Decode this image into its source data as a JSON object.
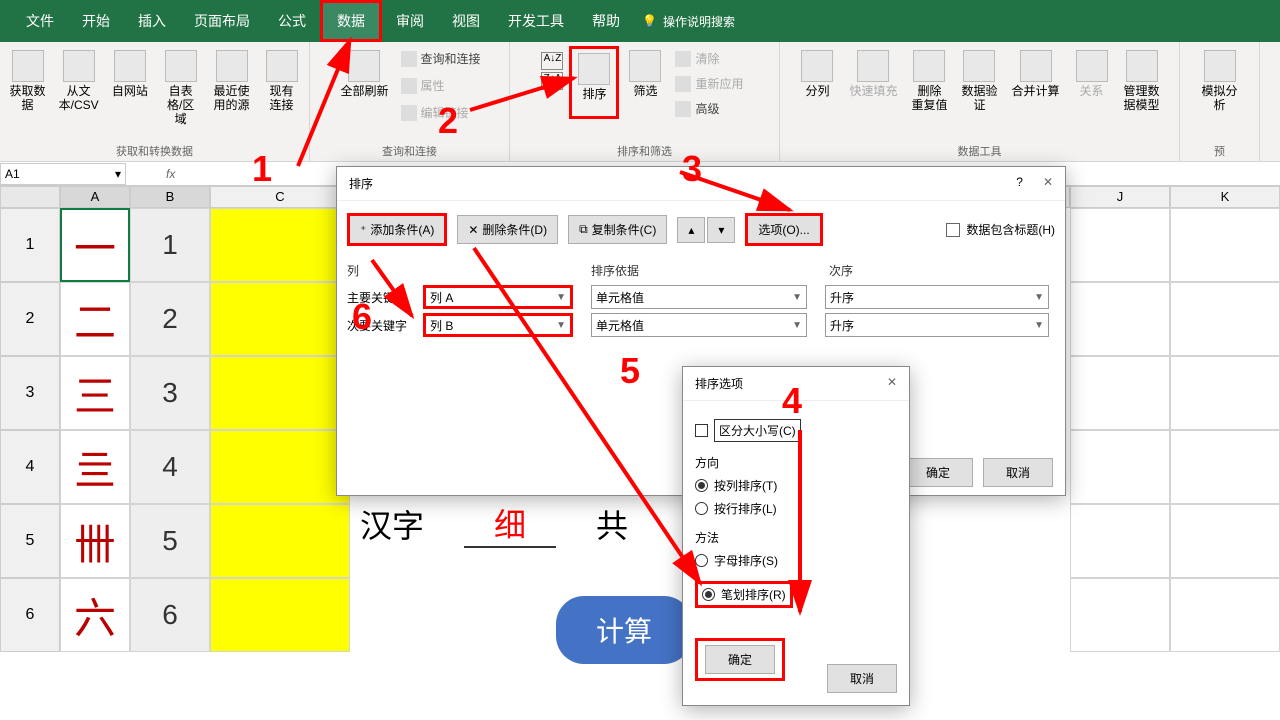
{
  "menu": {
    "file": "文件",
    "home": "开始",
    "insert": "插入",
    "layout": "页面布局",
    "formula": "公式",
    "data": "数据",
    "review": "审阅",
    "view": "视图",
    "dev": "开发工具",
    "help": "帮助",
    "tell": "操作说明搜索"
  },
  "ribbon": {
    "get": {
      "main": "获取数\n据",
      "csv": "从文\n本/CSV",
      "web": "自网站",
      "range": "自表\n格/区域",
      "recent": "最近使\n用的源",
      "exist": "现有\n连接",
      "label": "获取和转换数据"
    },
    "conn": {
      "refresh": "全部刷新",
      "q": "查询和连接",
      "prop": "属性",
      "link": "编辑链接",
      "label": "查询和连接"
    },
    "sortf": {
      "sort": "排序",
      "filter": "筛选",
      "clear": "清除",
      "reapply": "重新应用",
      "adv": "高级",
      "label": "排序和筛选"
    },
    "tools": {
      "split": "分列",
      "flash": "快速填充",
      "dup": "删除\n重复值",
      "valid": "数据验\n证",
      "consol": "合并计算",
      "rel": "关系",
      "model": "管理数\n据模型",
      "label": "数据工具"
    },
    "what": {
      "whatif": "模拟分析",
      "fore": "预"
    }
  },
  "namebox": "A1",
  "cols": [
    "A",
    "B",
    "C",
    "J",
    "K"
  ],
  "rows": [
    {
      "n": "1",
      "a": "一",
      "b": "1"
    },
    {
      "n": "2",
      "a": "二",
      "b": "2"
    },
    {
      "n": "3",
      "a": "三",
      "b": "3"
    },
    {
      "n": "4",
      "a": "亖",
      "b": "4"
    },
    {
      "n": "5",
      "a": "卌",
      "b": "5"
    },
    {
      "n": "6",
      "a": "六",
      "b": "6"
    }
  ],
  "mid": {
    "hanzi": "汉字",
    "xi": "细",
    "gong": "共",
    "btn": "计算"
  },
  "sortDlg": {
    "title": "排序",
    "help": "?",
    "close": "✕",
    "add": "添加条件(A)",
    "del": "删除条件(D)",
    "copy": "复制条件(C)",
    "opt": "选项(O)...",
    "header": "数据包含标题(H)",
    "c1": "列",
    "c2": "排序依据",
    "c3": "次序",
    "r1lab": "主要关键字",
    "r1col": "列 A",
    "r1on": "单元格值",
    "r1ord": "升序",
    "r2lab": "次要关键字",
    "r2col": "列 B",
    "r2on": "单元格值",
    "r2ord": "升序",
    "ok": "确定",
    "cancel": "取消"
  },
  "optDlg": {
    "title": "排序选项",
    "close": "✕",
    "case": "区分大小写(C)",
    "dir": "方向",
    "bycol": "按列排序(T)",
    "byrow": "按行排序(L)",
    "method": "方法",
    "pinyin": "字母排序(S)",
    "stroke": "笔划排序(R)",
    "ok": "确定",
    "cancel": "取消"
  },
  "anno": {
    "1": "1",
    "2": "2",
    "3": "3",
    "4": "4",
    "5": "5",
    "6": "6"
  }
}
